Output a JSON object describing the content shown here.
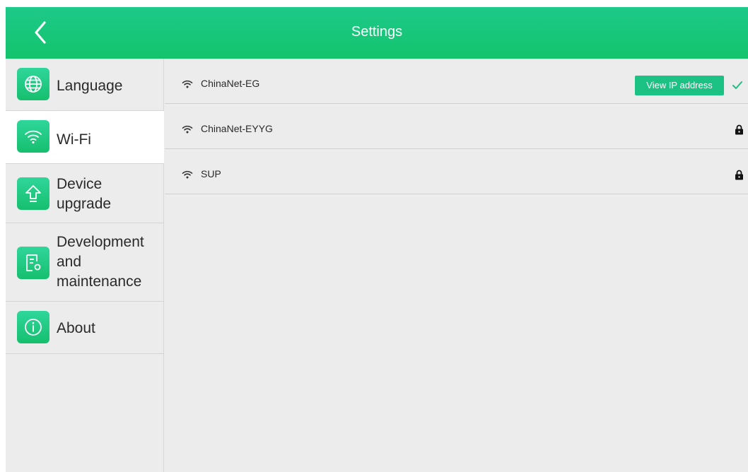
{
  "header": {
    "title": "Settings"
  },
  "sidebar": {
    "items": [
      {
        "label": "Language",
        "icon": "globe-icon"
      },
      {
        "label": "Wi-Fi",
        "icon": "wifi-icon",
        "active": true
      },
      {
        "label": "Device upgrade",
        "icon": "upgrade-arrow-icon"
      },
      {
        "label": "Development and maintenance",
        "icon": "document-settings-icon"
      },
      {
        "label": "About",
        "icon": "info-icon"
      }
    ]
  },
  "networks": [
    {
      "name": "ChinaNet-EG",
      "connected": true,
      "action_label": "View IP address"
    },
    {
      "name": "ChinaNet-EYYG",
      "locked": true
    },
    {
      "name": "SUP",
      "locked": true
    }
  ],
  "colors": {
    "accent": "#1cc184",
    "header_top": "#1ec98a",
    "background": "#ececec"
  }
}
